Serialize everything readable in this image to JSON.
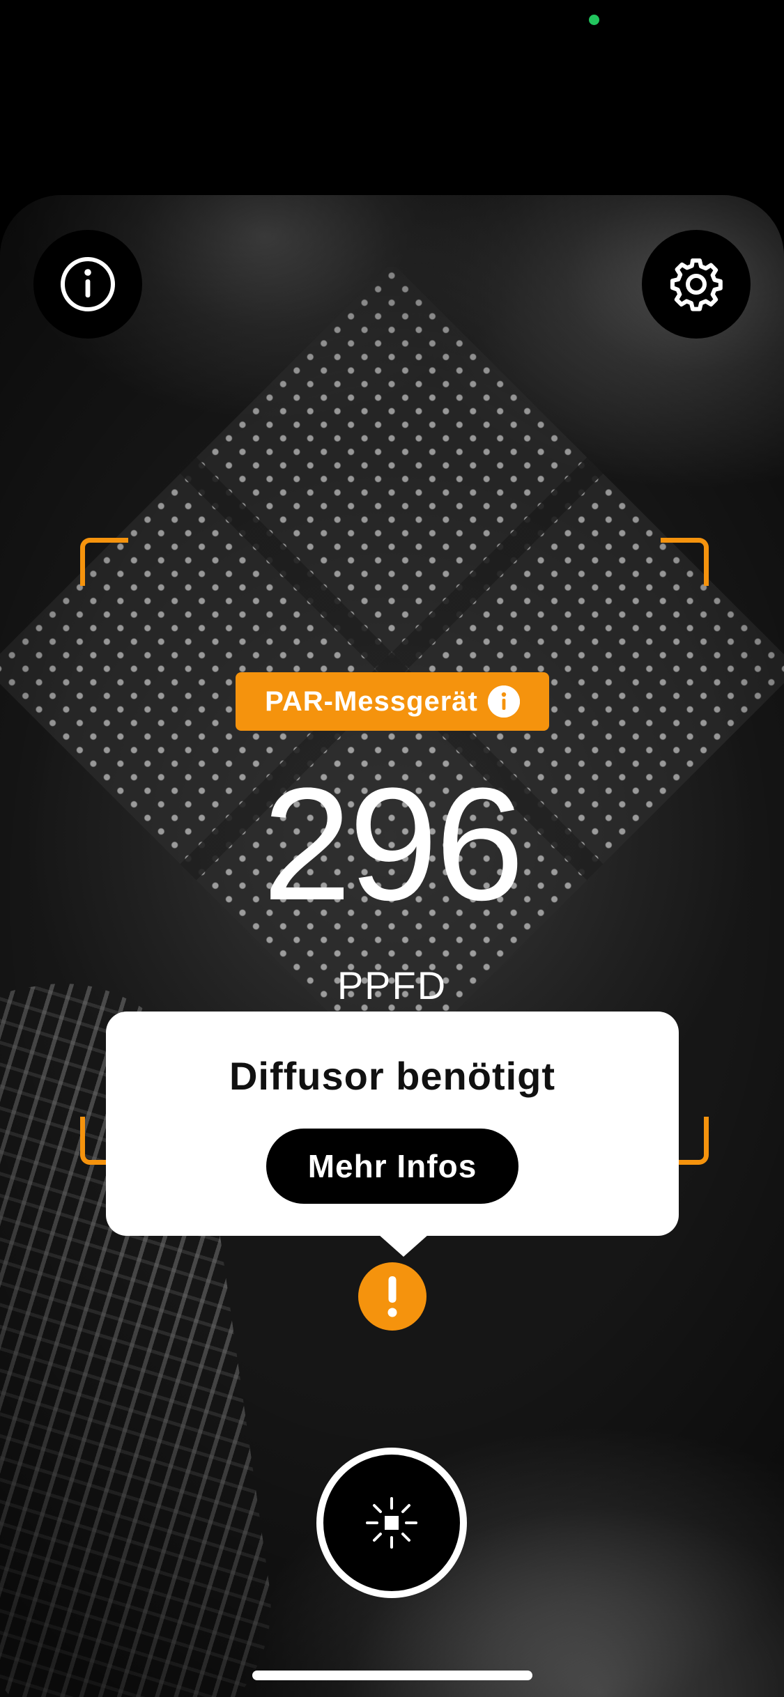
{
  "colors": {
    "accent": "#F5930D",
    "privacy_indicator": "#22C55E",
    "popover_bg": "#FFFFFF",
    "button_dark": "#000000"
  },
  "toolbar": {
    "info_icon": "info-icon",
    "settings_icon": "gear-icon"
  },
  "meter": {
    "label": "PAR-Messgerät",
    "label_icon": "info-icon",
    "value": "296",
    "unit": "PPFD"
  },
  "popover": {
    "title": "Diffusor benötigt",
    "button_label": "Mehr Infos"
  },
  "warning": {
    "icon": "exclamation-icon"
  },
  "capture": {
    "icon": "light-sun-icon"
  }
}
